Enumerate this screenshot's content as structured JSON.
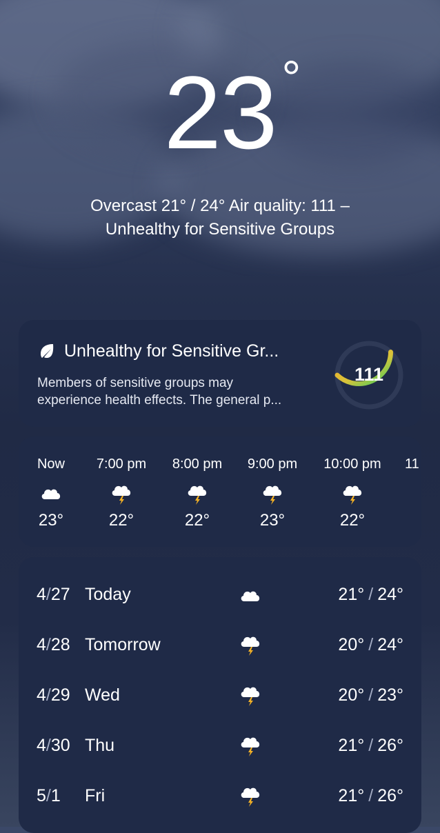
{
  "current": {
    "temperature": "23",
    "degree_symbol": "°",
    "summary_line1": "Overcast  21° / 24°  Air quality: 111 –",
    "summary_line2": "Unhealthy for Sensitive Groups"
  },
  "air_quality": {
    "title": "Unhealthy for Sensitive Gr...",
    "desc_line1": "Members of sensitive groups may",
    "desc_line2": "experience health effects. The general p...",
    "value": "111",
    "level_fraction": 0.37,
    "icon": "leaf-icon",
    "colors": {
      "track": "#2f3a57",
      "start": "#f5a623",
      "end": "#3ecf5e"
    }
  },
  "hourly": [
    {
      "time": "Now",
      "icon": "cloud-icon",
      "temp": "23°"
    },
    {
      "time": "7:00 pm",
      "icon": "thunderstorm-icon",
      "temp": "22°"
    },
    {
      "time": "8:00 pm",
      "icon": "thunderstorm-icon",
      "temp": "22°"
    },
    {
      "time": "9:00 pm",
      "icon": "thunderstorm-icon",
      "temp": "23°"
    },
    {
      "time": "10:00 pm",
      "icon": "thunderstorm-icon",
      "temp": "22°"
    },
    {
      "time": "11",
      "icon": "",
      "temp": ""
    }
  ],
  "daily": [
    {
      "month": "4",
      "day": "27",
      "name": "Today",
      "icon": "cloud-icon",
      "low": "21°",
      "high": "24°"
    },
    {
      "month": "4",
      "day": "28",
      "name": "Tomorrow",
      "icon": "thunderstorm-icon",
      "low": "20°",
      "high": "24°"
    },
    {
      "month": "4",
      "day": "29",
      "name": "Wed",
      "icon": "thunderstorm-icon",
      "low": "20°",
      "high": "23°"
    },
    {
      "month": "4",
      "day": "30",
      "name": "Thu",
      "icon": "thunderstorm-icon",
      "low": "21°",
      "high": "26°"
    },
    {
      "month": "5",
      "day": "1",
      "name": "Fri",
      "icon": "thunderstorm-icon",
      "low": "21°",
      "high": "26°"
    }
  ],
  "date_separator": "/",
  "temp_separator": "/"
}
